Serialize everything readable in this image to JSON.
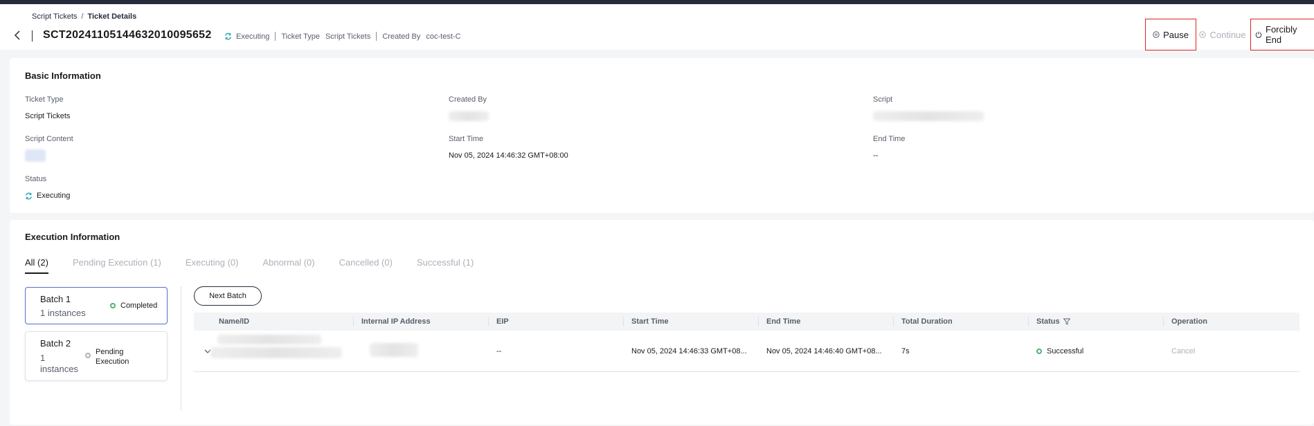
{
  "breadcrumb": {
    "root": "Script Tickets",
    "separator": "/",
    "current": "Ticket Details"
  },
  "ticket": {
    "id": "SCT20241105144632010095652",
    "status": "Executing",
    "ticket_type_label": "Ticket Type",
    "ticket_type": "Script Tickets",
    "created_by_label": "Created By",
    "created_by": "coc-test-C"
  },
  "actions": {
    "pause": "Pause",
    "continue": "Continue",
    "forcibly_end": "Forcibly End"
  },
  "basic_info": {
    "title": "Basic Information",
    "ticket_type_label": "Ticket Type",
    "ticket_type": "Script Tickets",
    "created_by_label": "Created By",
    "script_label": "Script",
    "script_content_label": "Script Content",
    "start_time_label": "Start Time",
    "start_time": "Nov 05, 2024 14:46:32 GMT+08:00",
    "end_time_label": "End Time",
    "end_time": "--",
    "status_label": "Status",
    "status": "Executing"
  },
  "execution": {
    "title": "Execution Information",
    "tabs": [
      {
        "label": "All (2)",
        "active": true
      },
      {
        "label": "Pending Execution (1)",
        "active": false
      },
      {
        "label": "Executing (0)",
        "active": false
      },
      {
        "label": "Abnormal (0)",
        "active": false
      },
      {
        "label": "Cancelled (0)",
        "active": false
      },
      {
        "label": "Successful (1)",
        "active": false
      }
    ],
    "batches": [
      {
        "name": "Batch 1",
        "count": "1 instances",
        "status": "Completed"
      },
      {
        "name": "Batch 2",
        "count_line1": "1",
        "count_line2": "instances",
        "status_line1": "Pending",
        "status_line2": "Execution"
      }
    ],
    "next_batch": "Next Batch",
    "columns": [
      "Name/ID",
      "Internal IP Address",
      "EIP",
      "Start Time",
      "End Time",
      "Total Duration",
      "Status",
      "Operation"
    ],
    "rows": [
      {
        "eip": "--",
        "start_time": "Nov 05, 2024 14:46:33 GMT+08...",
        "end_time": "Nov 05, 2024 14:46:40 GMT+08...",
        "duration": "7s",
        "status": "Successful",
        "operation": "Cancel"
      }
    ]
  },
  "colors": {
    "accent": "#526ecc",
    "success": "#50b371",
    "executing": "#2aa3b5",
    "highlight": "#e02020"
  },
  "icons": [
    "chevron-left-icon",
    "sync-icon",
    "pause-circle-icon",
    "play-circle-icon",
    "power-icon",
    "chevron-down-icon",
    "filter-icon"
  ]
}
